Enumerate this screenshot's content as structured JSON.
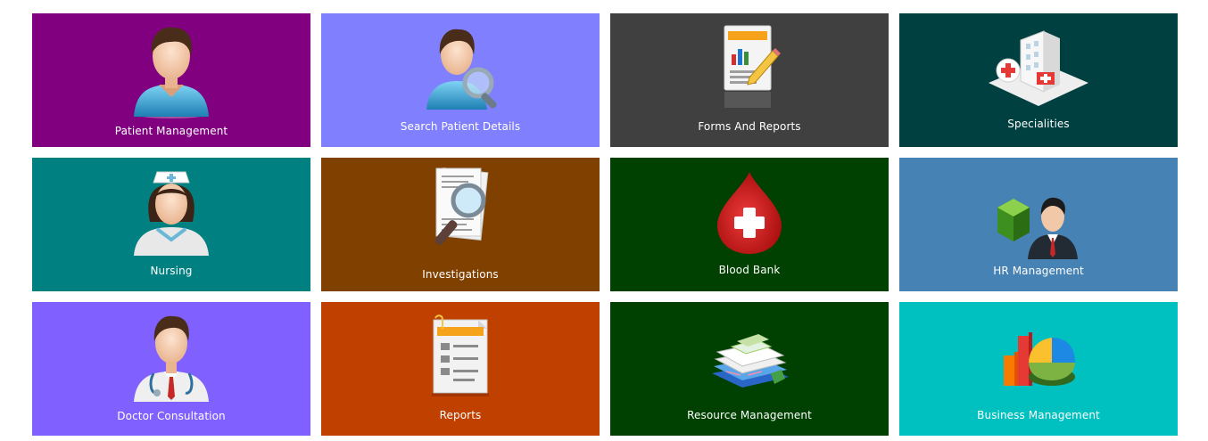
{
  "tiles": [
    {
      "label": "Patient Management",
      "color": "#800080",
      "icon": "patient-icon"
    },
    {
      "label": "Search Patient Details",
      "color": "#8080ff",
      "icon": "search-patient-icon"
    },
    {
      "label": "Forms And Reports",
      "color": "#404040",
      "icon": "forms-reports-icon"
    },
    {
      "label": "Specialities",
      "color": "#004040",
      "icon": "hospital-icon"
    },
    {
      "label": "Nursing",
      "color": "#008080",
      "icon": "nurse-icon"
    },
    {
      "label": "Investigations",
      "color": "#804000",
      "icon": "investigation-icon"
    },
    {
      "label": "Blood Bank",
      "color": "#004000",
      "icon": "blood-drop-icon"
    },
    {
      "label": "HR Management",
      "color": "#4682b4",
      "icon": "hr-icon"
    },
    {
      "label": "Doctor Consultation",
      "color": "#8060ff",
      "icon": "doctor-icon"
    },
    {
      "label": "Reports",
      "color": "#c04000",
      "icon": "reports-icon"
    },
    {
      "label": "Resource Management",
      "color": "#004000",
      "icon": "resource-icon"
    },
    {
      "label": "Business Management",
      "color": "#00c0c0",
      "icon": "business-chart-icon"
    }
  ]
}
